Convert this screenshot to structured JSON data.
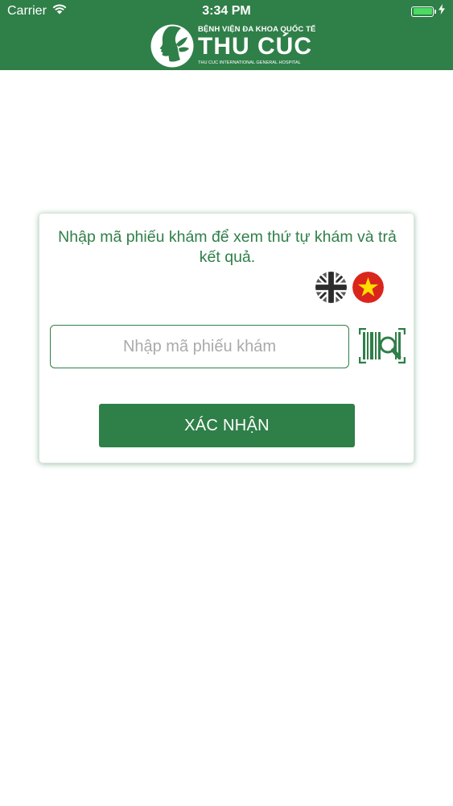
{
  "status_bar": {
    "carrier": "Carrier",
    "time": "3:34 PM",
    "battery_level": 1.0,
    "icons": [
      "wifi-icon",
      "battery-icon",
      "charging-bolt-icon"
    ]
  },
  "header": {
    "logo_icon": "hospital-logo-icon",
    "logo_top_text": "BỆNH VIỆN ĐA KHOA QUỐC TẾ",
    "logo_main_text": "THU CÚC",
    "logo_sub_text": "THU CUC INTERNATIONAL GENERAL HOSPITAL"
  },
  "card": {
    "message": "Nhập mã phiếu khám để xem thứ tự khám và trả kết quả.",
    "languages": [
      {
        "icon": "uk-flag-icon",
        "code": "en"
      },
      {
        "icon": "vietnam-flag-icon",
        "code": "vi"
      }
    ],
    "input": {
      "value": "",
      "placeholder": "Nhập mã phiếu khám"
    },
    "scan_icon": "barcode-scan-icon",
    "confirm_label": "XÁC NHẬN"
  },
  "colors": {
    "brand_green": "#2f7f48",
    "placeholder_gray": "#aaaaaa",
    "vietnam_red": "#da251d",
    "vietnam_star": "#ffde00",
    "flag_gray": "#5a5a5a"
  }
}
